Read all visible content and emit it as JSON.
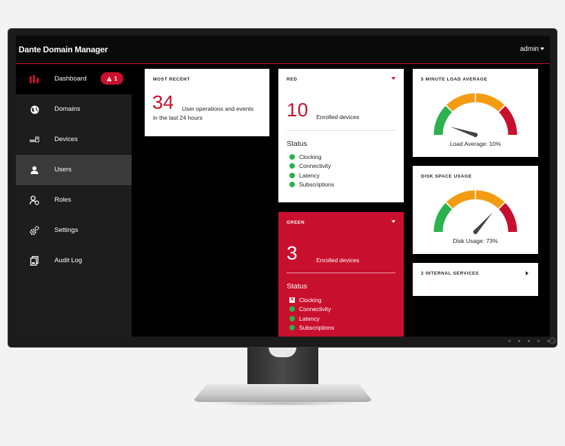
{
  "app": {
    "title": "Dante Domain Manager",
    "user": "admin"
  },
  "sidebar": {
    "items": [
      {
        "label": "Dashboard",
        "icon": "bar-chart-icon",
        "badge": "1",
        "badge_icon": "warning-icon"
      },
      {
        "label": "Domains",
        "icon": "globe-icon"
      },
      {
        "label": "Devices",
        "icon": "devices-icon"
      },
      {
        "label": "Users",
        "icon": "user-icon"
      },
      {
        "label": "Roles",
        "icon": "roles-icon"
      },
      {
        "label": "Settings",
        "icon": "gears-icon"
      },
      {
        "label": "Audit Log",
        "icon": "audit-log-icon"
      }
    ]
  },
  "cards": {
    "most_recent": {
      "title": "MOST RECENT",
      "value": "34",
      "desc_line1": "User operations and events",
      "desc_line2": "in the last 24 hours"
    },
    "red": {
      "title": "RED",
      "value": "10",
      "desc": "Enrolled devices",
      "status_heading": "Status",
      "status": [
        {
          "label": "Clocking",
          "state": "ok"
        },
        {
          "label": "Connectivity",
          "state": "ok"
        },
        {
          "label": "Latency",
          "state": "ok"
        },
        {
          "label": "Subscriptions",
          "state": "ok"
        }
      ]
    },
    "green": {
      "title": "GREEN",
      "value": "3",
      "desc": "Enrolled devices",
      "status_heading": "Status",
      "status": [
        {
          "label": "Clocking",
          "state": "error"
        },
        {
          "label": "Connectivity",
          "state": "ok"
        },
        {
          "label": "Latency",
          "state": "ok"
        },
        {
          "label": "Subscriptions",
          "state": "ok"
        }
      ]
    },
    "load": {
      "title": "5 MINUTE LOAD AVERAGE",
      "label": "Load Average: 10%",
      "percent": 10
    },
    "disk": {
      "title": "DISK SPACE USAGE",
      "label": "Disk Usage: 73%",
      "percent": 73
    },
    "services": {
      "title": "2 INTERNAL SERVICES"
    }
  },
  "colors": {
    "accent": "#c8102e",
    "ok": "#2bb24c",
    "gauge_green": "#2bb24c",
    "gauge_orange": "#f39c12",
    "gauge_red": "#c8102e"
  }
}
